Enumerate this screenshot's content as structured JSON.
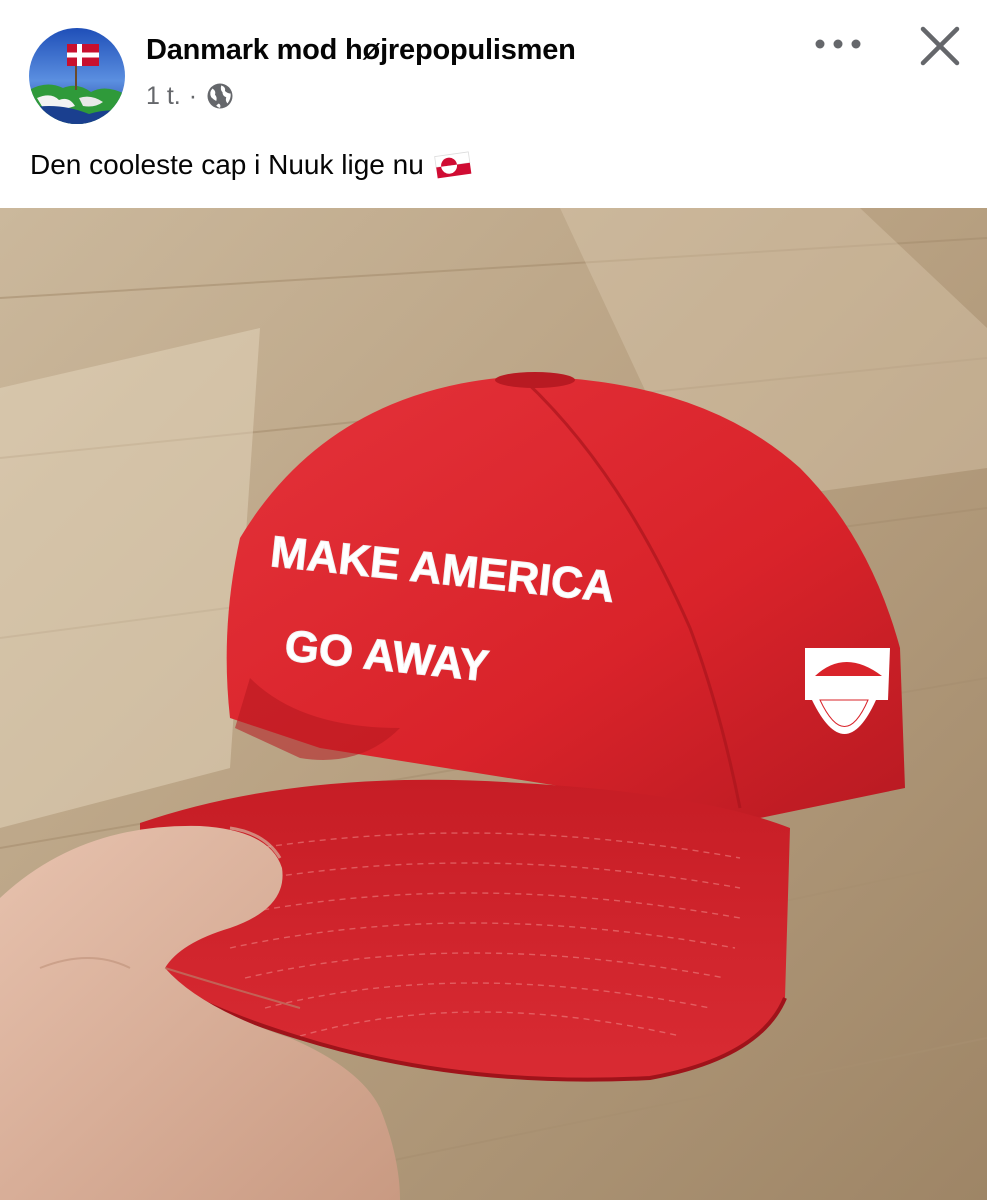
{
  "post": {
    "page_name": "Danmark mod højrepopulismen",
    "timestamp": "1 t.",
    "separator": "·",
    "audience_icon": "globe-icon",
    "text": "Den cooleste cap i Nuuk lige nu",
    "emoji": "greenland-flag-emoji"
  },
  "actions": {
    "more_icon": "more-horizontal-icon",
    "close_icon": "close-icon"
  },
  "photo": {
    "cap_line_1": "MAKE AMERICA",
    "cap_line_2": "GO AWAY",
    "cap_color": "#d9232a",
    "floor_color": "#b9a283"
  }
}
